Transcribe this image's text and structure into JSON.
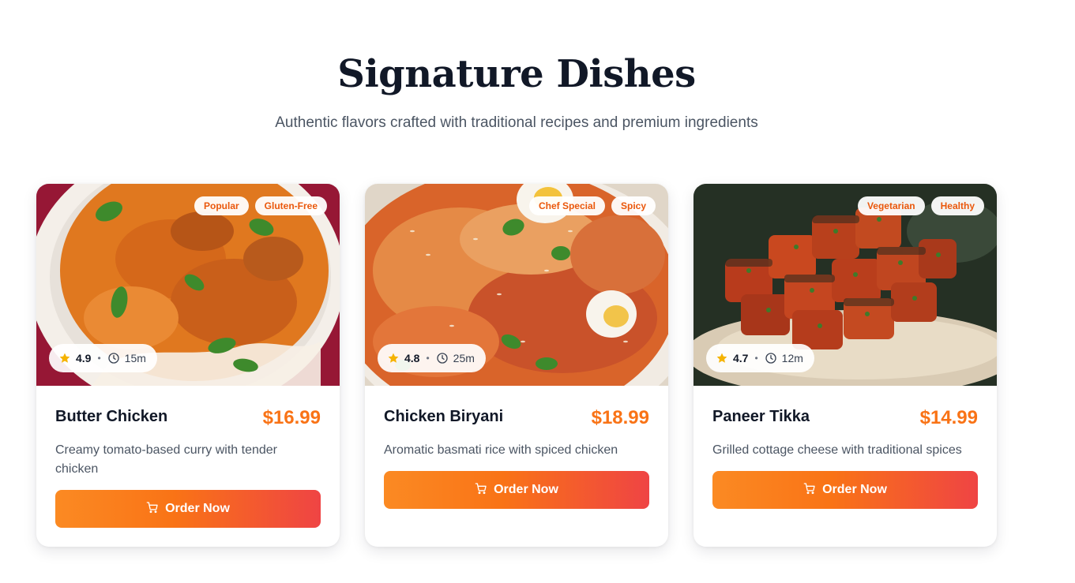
{
  "section": {
    "title": "Signature Dishes",
    "subtitle": "Authentic flavors crafted with traditional recipes and premium ingredients"
  },
  "colors": {
    "accent": "#f97316",
    "gradient_start": "#fb8a23",
    "gradient_end": "#ef4444",
    "star": "#f5b301"
  },
  "icons": {
    "rating": "star-icon",
    "time": "clock-icon",
    "order": "cart-icon"
  },
  "dishes": [
    {
      "name": "Butter Chicken",
      "price": "$16.99",
      "description": "Creamy tomato-based curry with tender chicken",
      "tags": [
        "Popular",
        "Gluten-Free"
      ],
      "rating": "4.9",
      "time": "15m",
      "button_label": "Order Now"
    },
    {
      "name": "Chicken Biryani",
      "price": "$18.99",
      "description": "Aromatic basmati rice with spiced chicken",
      "tags": [
        "Chef Special",
        "Spicy"
      ],
      "rating": "4.8",
      "time": "25m",
      "button_label": "Order Now"
    },
    {
      "name": "Paneer Tikka",
      "price": "$14.99",
      "description": "Grilled cottage cheese with traditional spices",
      "tags": [
        "Vegetarian",
        "Healthy"
      ],
      "rating": "4.7",
      "time": "12m",
      "button_label": "Order Now"
    }
  ]
}
